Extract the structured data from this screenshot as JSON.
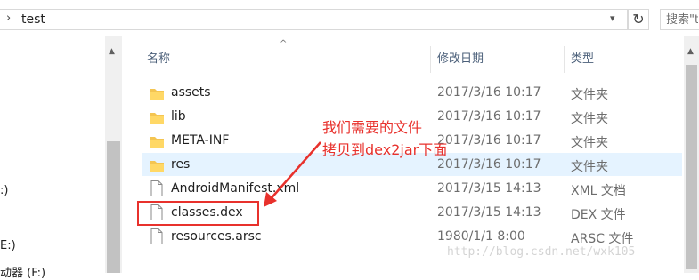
{
  "address_bar": {
    "separator": "›",
    "breadcrumb": "test",
    "dropdown_glyph": "▾",
    "refresh_glyph": "↻"
  },
  "search": {
    "placeholder": "搜索\"test\""
  },
  "navigation": {
    "items": [
      ":)",
      "E:)",
      "动器 (F:)"
    ]
  },
  "columns": {
    "name": "名称",
    "date": "修改日期",
    "type": "类型",
    "sort_indicator": "^"
  },
  "files": [
    {
      "name": "assets",
      "date": "2017/3/16 10:17",
      "type": "文件夹",
      "icon": "folder-icon"
    },
    {
      "name": "lib",
      "date": "2017/3/16 10:17",
      "type": "文件夹",
      "icon": "folder-icon"
    },
    {
      "name": "META-INF",
      "date": "2017/3/16 10:17",
      "type": "文件夹",
      "icon": "folder-icon"
    },
    {
      "name": "res",
      "date": "2017/3/16 10:17",
      "type": "文件夹",
      "icon": "folder-icon"
    },
    {
      "name": "AndroidManifest.xml",
      "date": "2017/3/15 14:13",
      "type": "XML 文档",
      "icon": "document-icon"
    },
    {
      "name": "classes.dex",
      "date": "2017/3/15 14:13",
      "type": "DEX 文件",
      "icon": "document-icon"
    },
    {
      "name": "resources.arsc",
      "date": "1980/1/1 8:00",
      "type": "ARSC 文件",
      "icon": "document-icon"
    }
  ],
  "annotation": {
    "line1": "我们需要的文件",
    "line2": "拷贝到dex2jar下面",
    "color": "#e8312c"
  },
  "watermark": "http://blog.csdn.net/wxk105",
  "colors": {
    "folder": "#f4c552",
    "selected_row": "#e5f3ff",
    "header_text": "#4c607a"
  }
}
